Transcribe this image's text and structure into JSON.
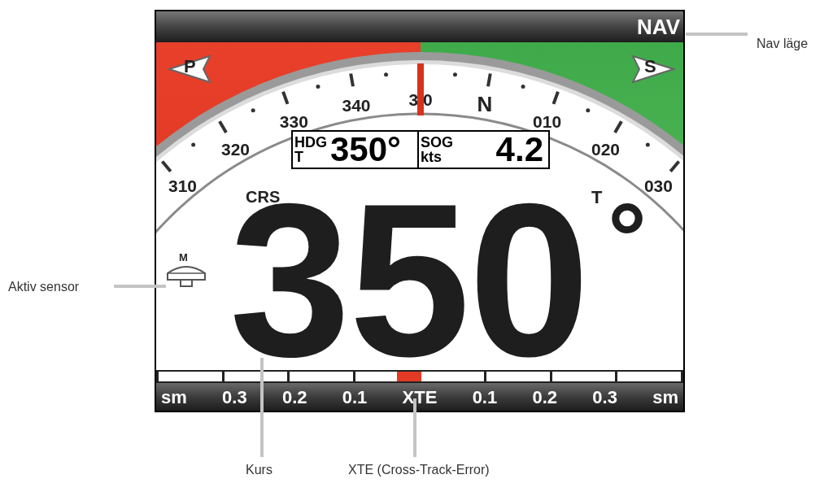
{
  "screen": {
    "header": {
      "mode": "NAV"
    },
    "compass": {
      "markers": [
        {
          "kind": "port",
          "letter": "P"
        },
        {
          "kind": "starboard",
          "letter": "S"
        }
      ],
      "scale_labels": [
        "310",
        "320",
        "330",
        "340",
        "3 0",
        "N",
        "010",
        "020",
        "030"
      ],
      "heading_box": {
        "hdg_label": "HDG",
        "hdg_ref": "T",
        "hdg_value": "350°",
        "sog_label": "SOG",
        "sog_unit": "kts",
        "sog_value": "4.2"
      },
      "crs_label": "CRS",
      "ref_label": "T",
      "sensor_label": "M",
      "course": "350",
      "course_unit": "°"
    },
    "xte": {
      "level": 0.48,
      "labels": [
        "sm",
        "0.3",
        "0.2",
        "0.1",
        "XTE",
        "0.1",
        "0.2",
        "0.3",
        "sm"
      ]
    }
  },
  "callouts": {
    "nav_mode": "Nav läge",
    "active_sensor": "Aktiv sensor",
    "course": "Kurs",
    "xte": "XTE (Cross-Track-Error)"
  }
}
